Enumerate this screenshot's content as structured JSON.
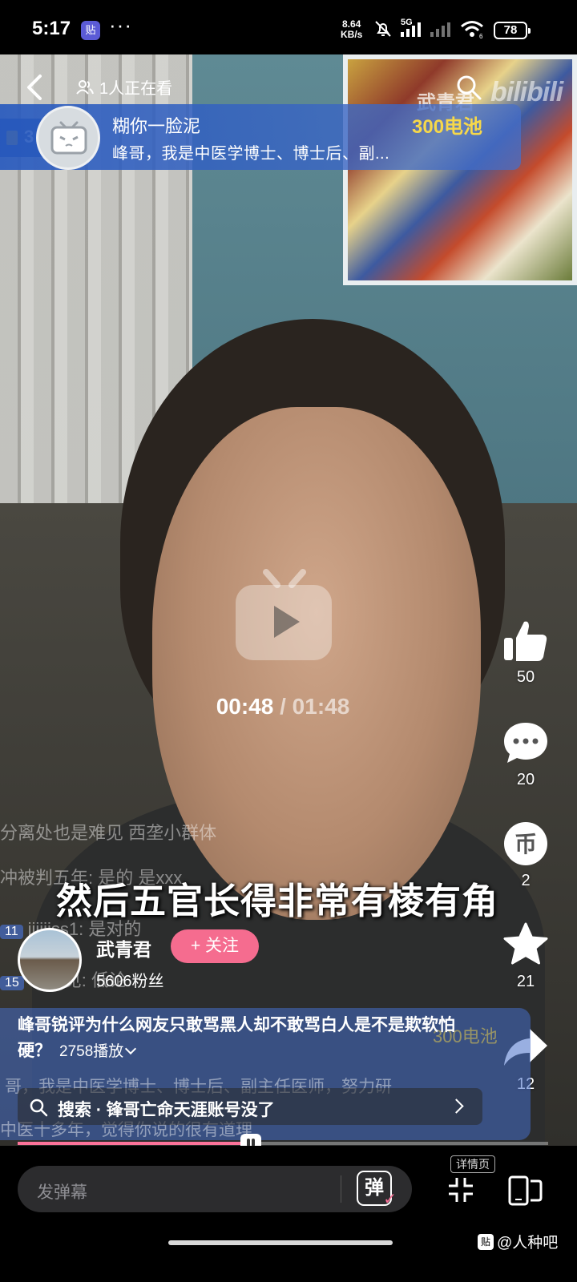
{
  "status_bar": {
    "time": "5:17",
    "app_badge": "贴",
    "more": "···",
    "net_speed_value": "8.64",
    "net_speed_unit": "KB/s",
    "network": "5G",
    "wifi_badge": "6",
    "battery": "78"
  },
  "player": {
    "viewers": "1人正在看",
    "watermark_name": "武青君",
    "brand": "bilibili",
    "current_time": "00:48",
    "separator": "/",
    "total_time": "01:48",
    "subtitle": "然后五官长得非常有棱有角",
    "progress_fraction": 0.44
  },
  "gift_banner": {
    "left_count": "3",
    "user": "糊你一脸泥",
    "amount": "300电池",
    "message": "峰哥，我是中医学博士、博士后、副..."
  },
  "danmaku": [
    {
      "text": "分离处也是难见 西垄小群体"
    },
    {
      "text": "冲被判五年: 是的 是xxx"
    },
    {
      "badge": "11",
      "text": "jjjjiiss1: 是对的"
    },
    {
      "badge": "15",
      "text": "若初见: 低论"
    }
  ],
  "comment_banner": {
    "amount": "300电池",
    "line1": "哥，我是中医学博士、博士后、副主任医师，努力研",
    "line2": "中医十多年，觉得你说的很有道理"
  },
  "actions": {
    "like_count": "50",
    "comment_count": "20",
    "coin_count": "2",
    "coin_symbol": "币",
    "favorite_count": "21",
    "share_count": "12"
  },
  "author": {
    "name": "武青君",
    "follow_label": "+ 关注",
    "fans": "5606粉丝"
  },
  "video": {
    "title": "峰哥锐评为什么网友只敢骂黑人却不敢骂白人是不是欺软怕硬？",
    "plays": "2758播放"
  },
  "search": {
    "text": "搜索 · 锋哥亡命天涯账号没了"
  },
  "bottom_bar": {
    "danmaku_placeholder": "发弹幕",
    "danmaku_toggle": "弹",
    "detail_label": "详情页"
  },
  "source_watermark": {
    "icon": "贴",
    "text": "@人种吧"
  },
  "colors": {
    "accent_pink": "#fb7299",
    "follow_pink": "#f56c8f",
    "gift_gold": "#f6d84a",
    "banner_blue": "#285abe"
  }
}
